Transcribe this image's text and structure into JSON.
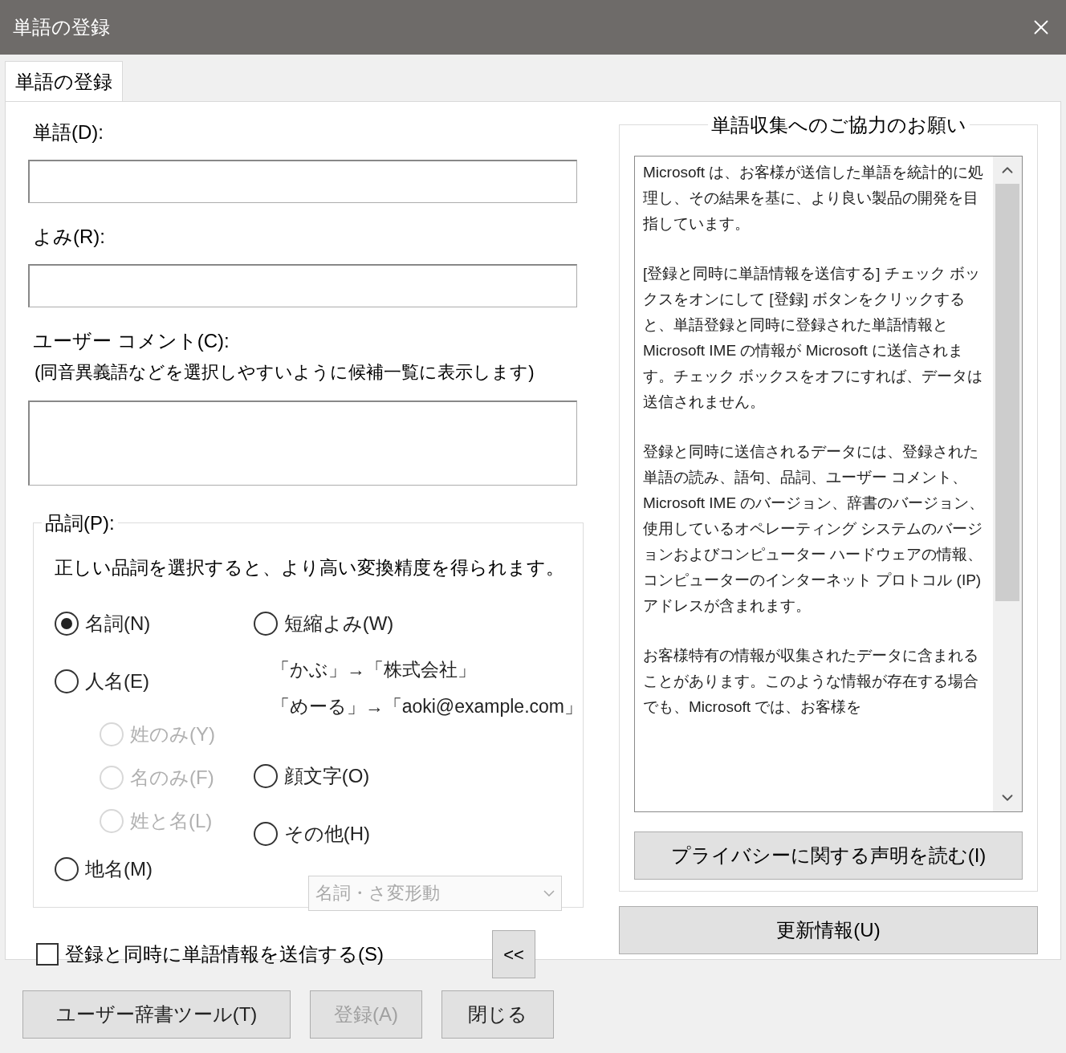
{
  "window": {
    "title": "単語の登録"
  },
  "tabs": [
    {
      "label": "単語の登録",
      "selected": true
    }
  ],
  "fields": [
    {
      "label": "単語(D):",
      "multiline": false
    },
    {
      "label": "よみ(R):",
      "multiline": false
    },
    {
      "label": "ユーザー コメント(C):",
      "hint": "(同音異義語などを選択しやすいように候補一覧に表示します)",
      "multiline": true
    }
  ],
  "part_of_speech": {
    "title": "品詞(P):",
    "description": "正しい品詞を選択すると、より高い変換精度を得られます。",
    "left": [
      {
        "label": "名詞(N)",
        "selected": true,
        "disabled": false
      },
      {
        "label": "人名(E)",
        "selected": false,
        "disabled": false,
        "children": [
          {
            "label": "姓のみ(Y)",
            "selected": false,
            "disabled": true
          },
          {
            "label": "名のみ(F)",
            "selected": false,
            "disabled": true
          },
          {
            "label": "姓と名(L)",
            "selected": false,
            "disabled": true
          }
        ]
      },
      {
        "label": "地名(M)",
        "selected": false,
        "disabled": false
      }
    ],
    "right": [
      {
        "kind": "radio",
        "label": "短縮よみ(W)",
        "selected": false,
        "disabled": false
      },
      {
        "kind": "example",
        "label": "「かぶ」→「株式会社」"
      },
      {
        "kind": "example",
        "label": "「めーる」→「aoki@example.com」"
      },
      {
        "kind": "radio",
        "label": "顔文字(O)",
        "selected": false,
        "disabled": false
      },
      {
        "kind": "radio",
        "label": "その他(H)",
        "selected": false,
        "disabled": false
      }
    ],
    "dropdown": {
      "value": "名詞・さ変形動",
      "disabled": true
    }
  },
  "send_checkbox": {
    "label": "登録と同時に単語情報を送信する(S)",
    "checked": false
  },
  "collapse_button": "<<",
  "info": {
    "title": "単語収集へのご協力のお願い",
    "paragraphs": [
      "Microsoft は、お客様が送信した単語を統計的に処理し、その結果を基に、より良い製品の開発を目指しています。",
      "[登録と同時に単語情報を送信する] チェック ボックスをオンにして [登録] ボタンをクリックすると、単語登録と同時に登録された単語情報と Microsoft IME の情報が Microsoft に送信されます。チェック ボックスをオフにすれば、データは送信されません。",
      "登録と同時に送信されるデータには、登録された単語の読み、語句、品詞、ユーザー コメント、Microsoft IME のバージョン、辞書のバージョン、使用しているオペレーティング システムのバージョンおよびコンピューター ハードウェアの情報、コンピューターのインターネット プロトコル (IP) アドレスが含まれます。",
      "お客様特有の情報が収集されたデータに含まれることがあります。このような情報が存在する場合でも、Microsoft では、お客様を"
    ],
    "privacy_button": "プライバシーに関する声明を読む(I)"
  },
  "update_button": "更新情報(U)",
  "buttons": [
    {
      "label": "ユーザー辞書ツール(T)",
      "disabled": false
    },
    {
      "label": "登録(A)",
      "disabled": true
    },
    {
      "label": "閉じる",
      "disabled": false
    }
  ]
}
